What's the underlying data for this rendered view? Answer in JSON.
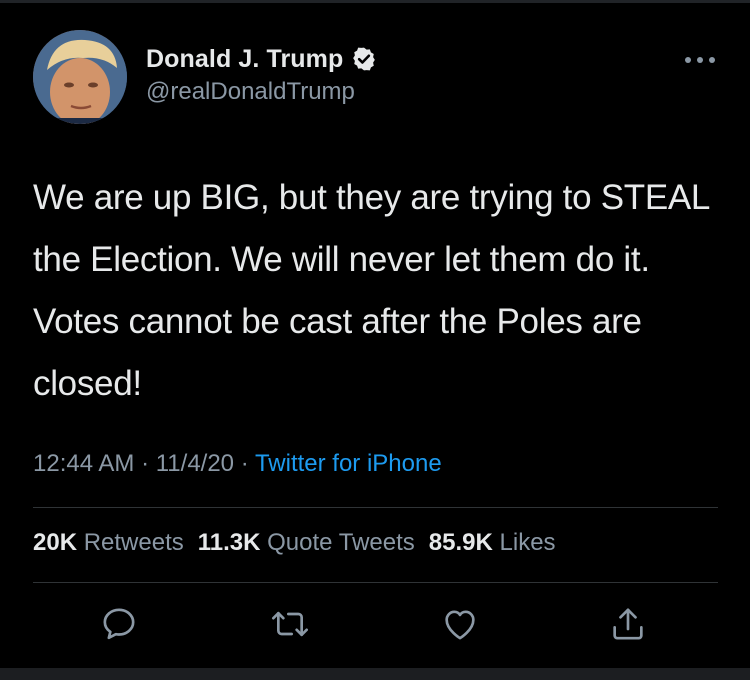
{
  "author": {
    "display_name": "Donald J. Trump",
    "handle": "@realDonaldTrump",
    "verified": true
  },
  "tweet": {
    "text": "We are up BIG, but they are trying to STEAL the Election. We will never let them do it. Votes cannot be cast after the Poles are closed!",
    "time": "12:44 AM",
    "separator": " · ",
    "date": "11/4/20",
    "source": "Twitter for iPhone"
  },
  "stats": {
    "retweets_count": "20K",
    "retweets_label": "Retweets",
    "quotes_count": "11.3K",
    "quotes_label": "Quote Tweets",
    "likes_count": "85.9K",
    "likes_label": "Likes"
  },
  "icons": {
    "more": "more-horizontal-icon",
    "verified": "verified-badge-icon",
    "reply": "reply-icon",
    "retweet": "retweet-icon",
    "like": "heart-icon",
    "share": "share-icon"
  },
  "colors": {
    "background": "#000000",
    "text": "#e7e9ea",
    "secondary": "#8b98a5",
    "link": "#1d9bf0",
    "divider": "#2f3336"
  }
}
